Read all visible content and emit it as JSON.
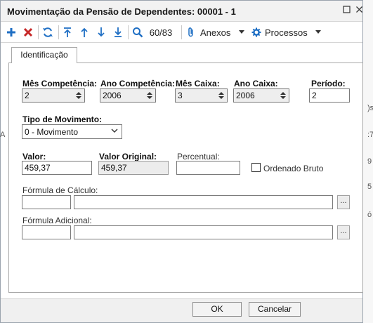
{
  "window": {
    "title": "Movimentação da Pensão de Dependentes: 00001 - 1"
  },
  "toolbar": {
    "record_position": "60/83",
    "attachments_label": "Anexos",
    "processes_label": "Processos"
  },
  "tab": {
    "label": "Identificação"
  },
  "form": {
    "mes_competencia": {
      "label": "Mês Competência:",
      "value": "2"
    },
    "ano_competencia": {
      "label": "Ano Competência:",
      "value": "2006"
    },
    "mes_caixa": {
      "label": "Mês Caixa:",
      "value": "3"
    },
    "ano_caixa": {
      "label": "Ano Caixa:",
      "value": "2006"
    },
    "periodo": {
      "label": "Período:",
      "value": "2"
    },
    "tipo_movimento": {
      "label": "Tipo de Movimento:",
      "value": "0 - Movimento"
    },
    "valor": {
      "label": "Valor:",
      "value": "459,37"
    },
    "valor_original": {
      "label": "Valor Original:",
      "value": "459,37"
    },
    "percentual": {
      "label": "Percentual:",
      "value": ""
    },
    "ordenado_bruto": {
      "label": "Ordenado Bruto",
      "checked": false
    },
    "formula_calculo": {
      "label": "Fórmula de Cálculo:",
      "code": "",
      "description": "",
      "lookup": "..."
    },
    "formula_adicional": {
      "label": "Fórmula Adicional:",
      "code": "",
      "description": "",
      "lookup": "..."
    }
  },
  "buttons": {
    "ok": "OK",
    "cancel": "Cancelar"
  },
  "background_fragments": {
    "left": [
      "A"
    ],
    "right": [
      ")s",
      ":7",
      "9",
      "5",
      "ó"
    ]
  },
  "colors": {
    "add_icon": "#1f6fc4",
    "delete_icon": "#c62828",
    "toolbar_icon": "#1f6fc4"
  }
}
